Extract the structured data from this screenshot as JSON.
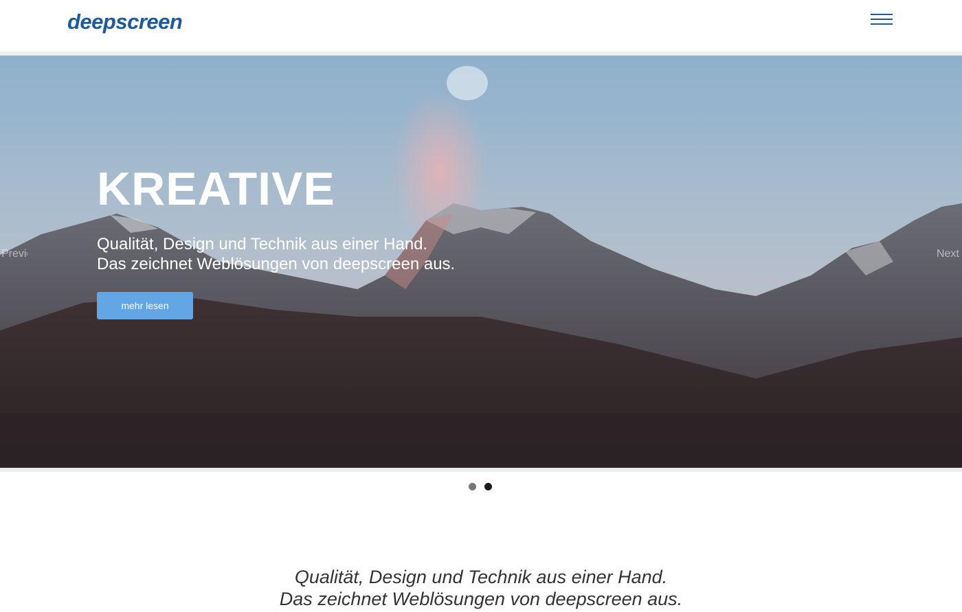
{
  "header": {
    "logo_text": "deepscreen",
    "menu_icon": "hamburger-icon"
  },
  "slider": {
    "title": "KREATIVE",
    "subtitle_line1": "Qualität, Design und Technik aus einer Hand.",
    "subtitle_line2": "Das zeichnet Weblösungen von deepscreen aus.",
    "button_label": "mehr lesen",
    "prev_label": "Previous",
    "next_label": "Next",
    "slide_count": 2,
    "active_slide": 2
  },
  "intro": {
    "line1": "Qualität, Design und Technik aus einer Hand.",
    "line2": "Das zeichnet Weblösungen von deepscreen aus."
  },
  "colors": {
    "brand": "#1c5a9c",
    "button": "#63a6e6"
  }
}
